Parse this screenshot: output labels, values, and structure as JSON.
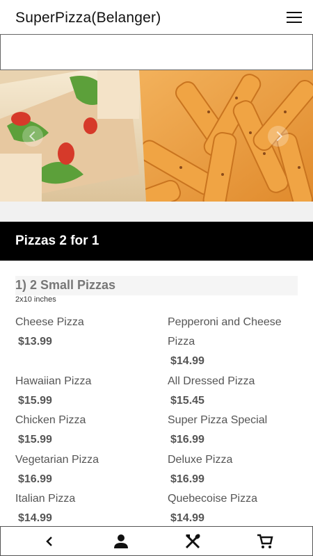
{
  "header": {
    "title": "SuperPizza(Belanger)",
    "menu_icon": "hamburger-menu-icon"
  },
  "search": {
    "value": "",
    "placeholder": ""
  },
  "hero": {
    "image": "club sandwich and fries photo",
    "prev_icon": "chevron-left-icon",
    "next_icon": "chevron-right-icon"
  },
  "section": {
    "title": "Pizzas 2 for 1"
  },
  "group": {
    "title": "1)  2 Small Pizzas",
    "subtitle": "2x10 inches",
    "items": [
      {
        "name": "Cheese Pizza",
        "price": "$13.99"
      },
      {
        "name": "Pepperoni and Cheese",
        "name2": "Pizza",
        "price": "$14.99"
      },
      {
        "name": "Hawaiian Pizza",
        "price": "$15.99"
      },
      {
        "name": "All Dressed Pizza",
        "price": "$15.45"
      },
      {
        "name": "Chicken Pizza",
        "price": "$15.99"
      },
      {
        "name": "Super Pizza Special",
        "price": "$16.99"
      },
      {
        "name": "Vegetarian Pizza",
        "price": "$16.99"
      },
      {
        "name": "Deluxe Pizza",
        "price": "$16.99"
      },
      {
        "name": "Italian Pizza",
        "price": "$14.99"
      },
      {
        "name": "Quebecoise Pizza",
        "price": "$14.99"
      }
    ]
  },
  "bottom_nav": [
    {
      "icon": "back-chevron-icon"
    },
    {
      "icon": "user-icon"
    },
    {
      "icon": "fork-knife-icon"
    },
    {
      "icon": "cart-icon"
    }
  ],
  "colors": {
    "section_bar": "#000000",
    "text": "#555555",
    "background": "#ffffff"
  }
}
